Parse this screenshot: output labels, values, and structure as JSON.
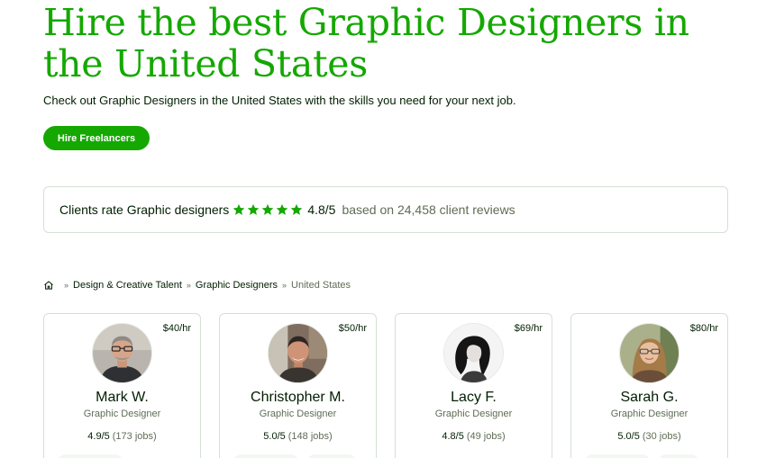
{
  "hero": {
    "title": "Hire the best Graphic Designers in the United States",
    "subtitle": "Check out Graphic Designers in the United States with the skills you need for your next job.",
    "cta_label": "Hire Freelancers"
  },
  "rating": {
    "label": "Clients rate Graphic designers",
    "stars": 5,
    "score": "4.8/5",
    "based_on": "based on 24,458 client reviews",
    "star_color": "#14a800"
  },
  "breadcrumb": {
    "home_icon": "home-icon",
    "items": [
      "Design & Creative Talent",
      "Graphic Designers",
      "United States"
    ],
    "separator": "»"
  },
  "freelancers": [
    {
      "name": "Mark W.",
      "title": "Graphic Designer",
      "rate": "$40/hr",
      "score": "4.9/5",
      "jobs": "(173 jobs)"
    },
    {
      "name": "Christopher M.",
      "title": "Graphic Designer",
      "rate": "$50/hr",
      "score": "5.0/5",
      "jobs": "(148 jobs)"
    },
    {
      "name": "Lacy F.",
      "title": "Graphic Designer",
      "rate": "$69/hr",
      "score": "4.8/5",
      "jobs": "(49 jobs)"
    },
    {
      "name": "Sarah G.",
      "title": "Graphic Designer",
      "rate": "$80/hr",
      "score": "5.0/5",
      "jobs": "(30 jobs)"
    }
  ],
  "colors": {
    "brand_green": "#14a800",
    "text_dark": "#001e00",
    "text_muted": "#5e6d55",
    "border": "#d5e0d5"
  }
}
